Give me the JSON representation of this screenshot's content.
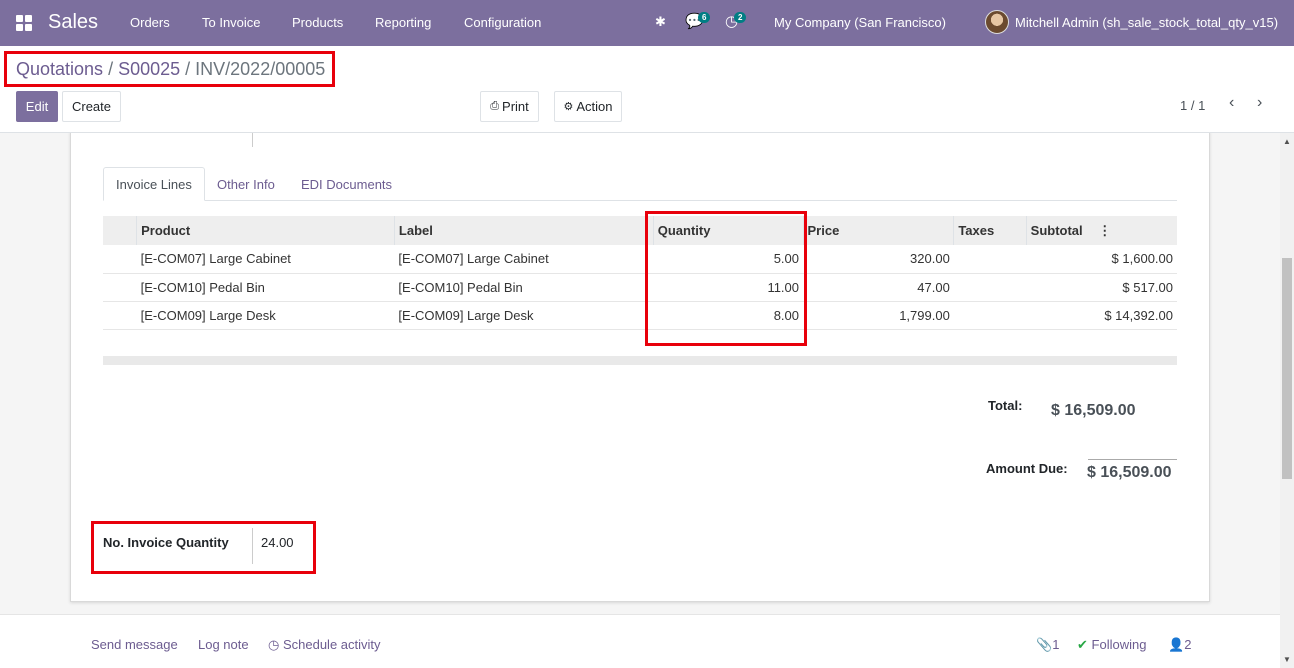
{
  "navbar": {
    "app_name": "Sales",
    "menu": [
      "Orders",
      "To Invoice",
      "Products",
      "Reporting",
      "Configuration"
    ],
    "messages_badge": "6",
    "activities_badge": "2",
    "company": "My Company (San Francisco)",
    "user": "Mitchell Admin (sh_sale_stock_total_qty_v15)",
    "accent_color": "#7c6f9e"
  },
  "breadcrumb": {
    "item1": "Quotations",
    "item2": "S00025",
    "current": "INV/2022/00005",
    "separator": "/"
  },
  "toolbar": {
    "edit": "Edit",
    "create": "Create",
    "print": "Print",
    "action": "Action",
    "pager": "1 / 1"
  },
  "tabs": [
    "Invoice Lines",
    "Other Info",
    "EDI Documents"
  ],
  "table": {
    "headers": {
      "product": "Product",
      "label": "Label",
      "quantity": "Quantity",
      "price": "Price",
      "taxes": "Taxes",
      "subtotal": "Subtotal"
    },
    "rows": [
      {
        "product": "[E-COM07] Large Cabinet",
        "label": "[E-COM07] Large Cabinet",
        "quantity": "5.00",
        "price": "320.00",
        "taxes": "",
        "subtotal": "$ 1,600.00"
      },
      {
        "product": "[E-COM10] Pedal Bin",
        "label": "[E-COM10] Pedal Bin",
        "quantity": "11.00",
        "price": "47.00",
        "taxes": "",
        "subtotal": "$ 517.00"
      },
      {
        "product": "[E-COM09] Large Desk",
        "label": "[E-COM09] Large Desk",
        "quantity": "8.00",
        "price": "1,799.00",
        "taxes": "",
        "subtotal": "$ 14,392.00"
      }
    ]
  },
  "totals": {
    "total_label": "Total:",
    "total_value": "$ 16,509.00",
    "due_label": "Amount Due:",
    "due_value": "$ 16,509.00"
  },
  "invoice_qty": {
    "label": "No. Invoice Quantity",
    "value": "24.00"
  },
  "chatter": {
    "send_message": "Send message",
    "log_note": "Log note",
    "schedule_activity": "Schedule activity",
    "attachments": "1",
    "following": "Following",
    "followers": "2"
  },
  "highlight_color": "#e8000b"
}
